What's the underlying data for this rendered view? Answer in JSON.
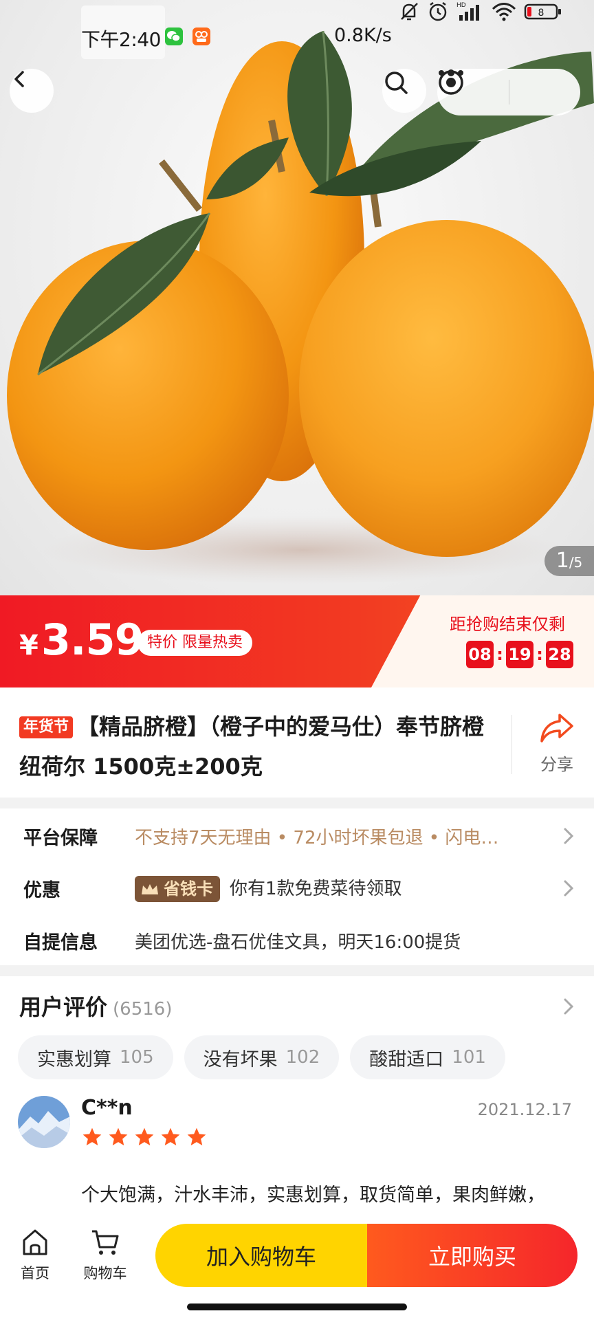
{
  "status_bar": {
    "time": "下午2:40",
    "network_speed": "0.8K/s",
    "battery": "8"
  },
  "gallery": {
    "current": "1",
    "total": "/5"
  },
  "price_banner": {
    "currency": "¥",
    "price": "3.59",
    "promo_tag": "特价 限量热卖",
    "countdown_label": "距抢购结束仅剩",
    "countdown": {
      "hours": "08",
      "minutes": "19",
      "seconds": "28"
    }
  },
  "product": {
    "tag": "年货节",
    "title": "【精品脐橙】（橙子中的爱马仕）奉节脐橙纽荷尔 1500克±200克",
    "share_label": "分享"
  },
  "info": {
    "guarantee": {
      "label": "平台保障",
      "value": "不支持7天无理由 • 72小时坏果包退 • 闪电…"
    },
    "discount": {
      "label": "优惠",
      "badge": "省钱卡",
      "value": "你有1款免费菜待领取"
    },
    "pickup": {
      "label": "自提信息",
      "value": "美团优选-盘石优佳文具，明天16:00提货"
    }
  },
  "reviews": {
    "title": "用户评价",
    "count": "(6516)",
    "chips": [
      {
        "label": "实惠划算",
        "count": "105"
      },
      {
        "label": "没有坏果",
        "count": "102"
      },
      {
        "label": "酸甜适口",
        "count": "101"
      }
    ],
    "first": {
      "user": "C**n",
      "date": "2021.12.17",
      "rating": 5,
      "text": "个大饱满，汁水丰沛，实惠划算，取货简单，果肉鲜嫩，"
    }
  },
  "bottom_bar": {
    "home_label": "首页",
    "cart_label": "购物车",
    "add_to_cart": "加入购物车",
    "buy_now": "立即购买"
  },
  "colors": {
    "accent_red": "#e8101c",
    "buy_yellow": "#ffd400",
    "orange_text": "#b98b62"
  }
}
